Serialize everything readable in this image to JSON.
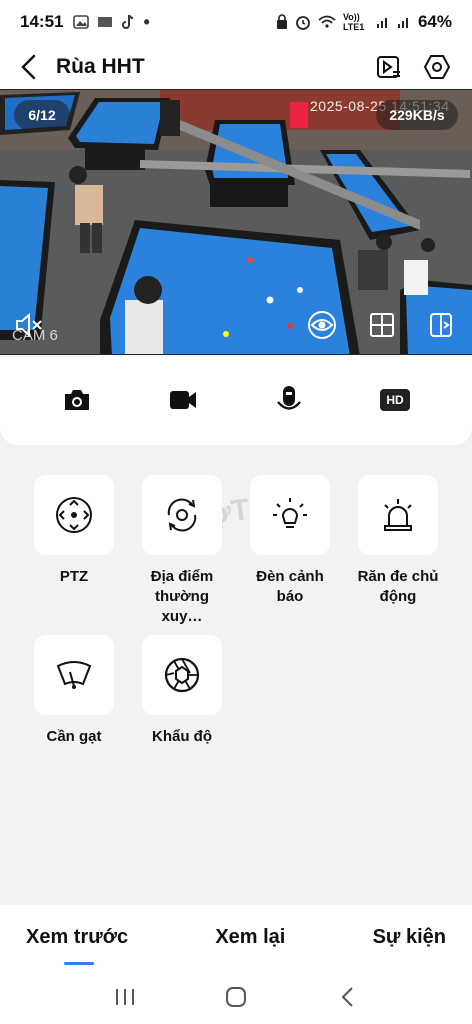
{
  "status": {
    "time": "14:51",
    "network": "Vo)) LTE1",
    "battery": "64%"
  },
  "header": {
    "title": "Rùa HHT"
  },
  "video": {
    "channel": "6/12",
    "speed": "229KB/s",
    "timestamp": "2025-08-25 14:51:34",
    "camera_label": "CAM 6"
  },
  "features": [
    {
      "label": "PTZ",
      "icon": "ptz-icon"
    },
    {
      "label": "Địa điểm thường xuy…",
      "icon": "preset-location-icon"
    },
    {
      "label": "Đèn cảnh báo",
      "icon": "warning-light-icon"
    },
    {
      "label": "Răn đe chủ động",
      "icon": "siren-icon"
    },
    {
      "label": "Cần gạt",
      "icon": "wiper-icon"
    },
    {
      "label": "Khẩu độ",
      "icon": "aperture-icon"
    }
  ],
  "toolbar": {
    "hd_label": "HD"
  },
  "watermark": "chợTốt",
  "bottom_nav": [
    {
      "label": "Xem trước",
      "active": true
    },
    {
      "label": "Xem lại",
      "active": false
    },
    {
      "label": "Sự kiện",
      "active": false
    }
  ],
  "colors": {
    "accent": "#2f7cf6",
    "table_felt": "#1f6fc9",
    "background": "#f2f2f4"
  }
}
